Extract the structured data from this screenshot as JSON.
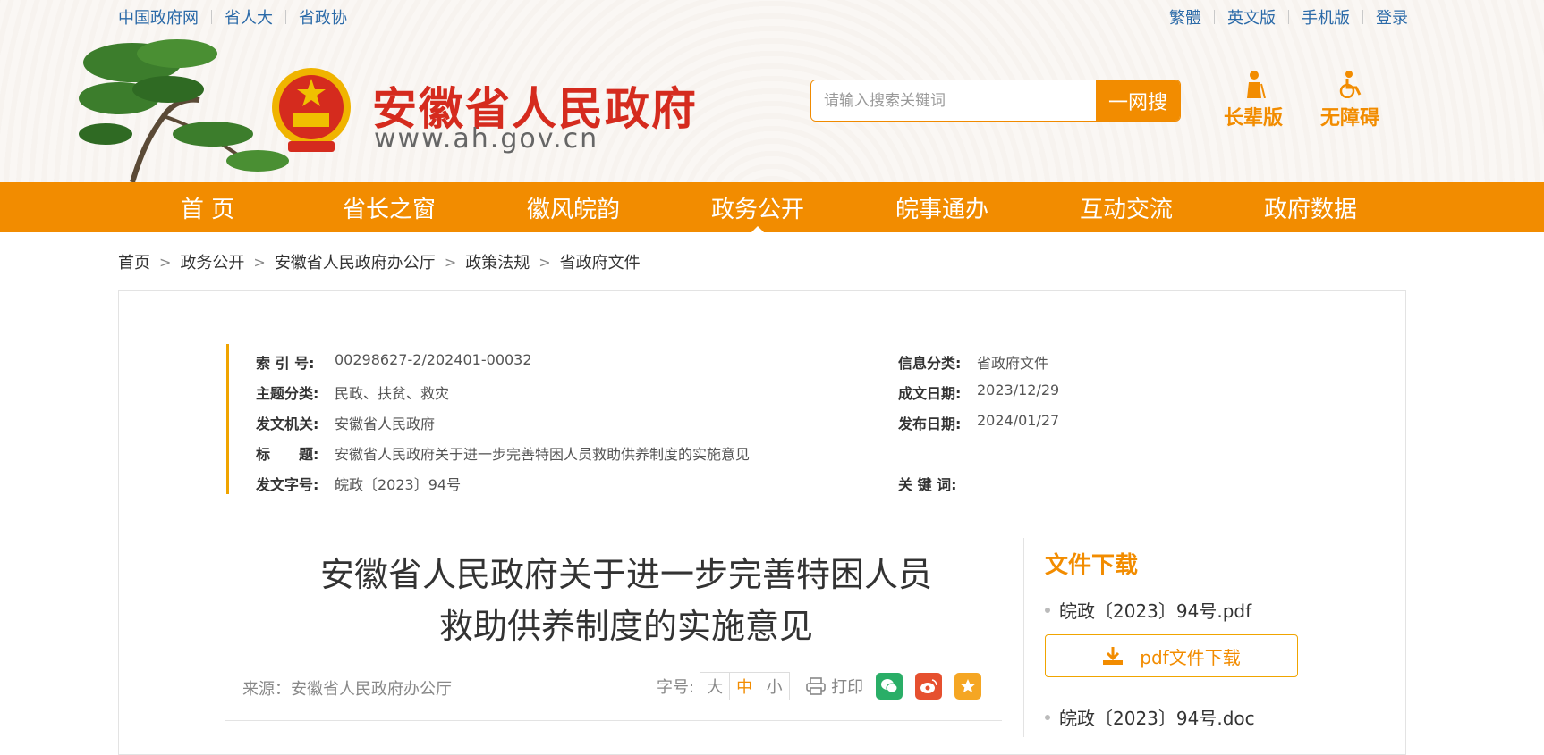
{
  "topbar": {
    "left_links": [
      "中国政府网",
      "省人大",
      "省政协"
    ],
    "right_links": [
      "繁體",
      "英文版",
      "手机版",
      "登录"
    ]
  },
  "header": {
    "site_title": "安徽省人民政府",
    "site_url": "www.ah.gov.cn",
    "search_placeholder": "请输入搜索关键词",
    "search_button": "一网搜",
    "elder_label": "长辈版",
    "accessible_label": "无障碍"
  },
  "nav": {
    "items": [
      "首 页",
      "省长之窗",
      "徽风皖韵",
      "政务公开",
      "皖事通办",
      "互动交流",
      "政府数据"
    ],
    "active": "政务公开"
  },
  "breadcrumb": [
    "首页",
    "政务公开",
    "安徽省人民政府办公厅",
    "政策法规",
    "省政府文件"
  ],
  "meta": {
    "index_key": "索 引 号:",
    "index_val": "00298627-2/202401-00032",
    "topic_key": "主题分类:",
    "topic_val": "民政、扶贫、救灾",
    "issuer_key": "发文机关:",
    "issuer_val": "安徽省人民政府",
    "title_key": "标　　题:",
    "title_val": "安徽省人民政府关于进一步完善特困人员救助供养制度的实施意见",
    "docno_key": "发文字号:",
    "docno_val": "皖政〔2023〕94号",
    "category_key": "信息分类:",
    "category_val": "省政府文件",
    "written_key": "成文日期:",
    "written_val": "2023/12/29",
    "published_key": "发布日期:",
    "published_val": "2024/01/27",
    "keywords_key": "关 键 词:",
    "keywords_val": ""
  },
  "article": {
    "title_line1": "安徽省人民政府关于进一步完善特困人员",
    "title_line2": "救助供养制度的实施意见",
    "source": "来源：安徽省人民政府办公厅",
    "font_label": "字号:",
    "font_sizes": [
      "大",
      "中",
      "小"
    ],
    "font_active": "中",
    "print_label": "打印"
  },
  "downloads": {
    "title": "文件下载",
    "files": [
      "皖政〔2023〕94号.pdf",
      "皖政〔2023〕94号.doc"
    ],
    "pdf_button": "pdf文件下载"
  },
  "colors": {
    "accent": "#f28c00",
    "title_red": "#d52b1e",
    "link_blue": "#2b6aa8",
    "wechat_green": "#2aae67",
    "weibo_red": "#e6502f",
    "favorite_orange": "#f5a623"
  }
}
